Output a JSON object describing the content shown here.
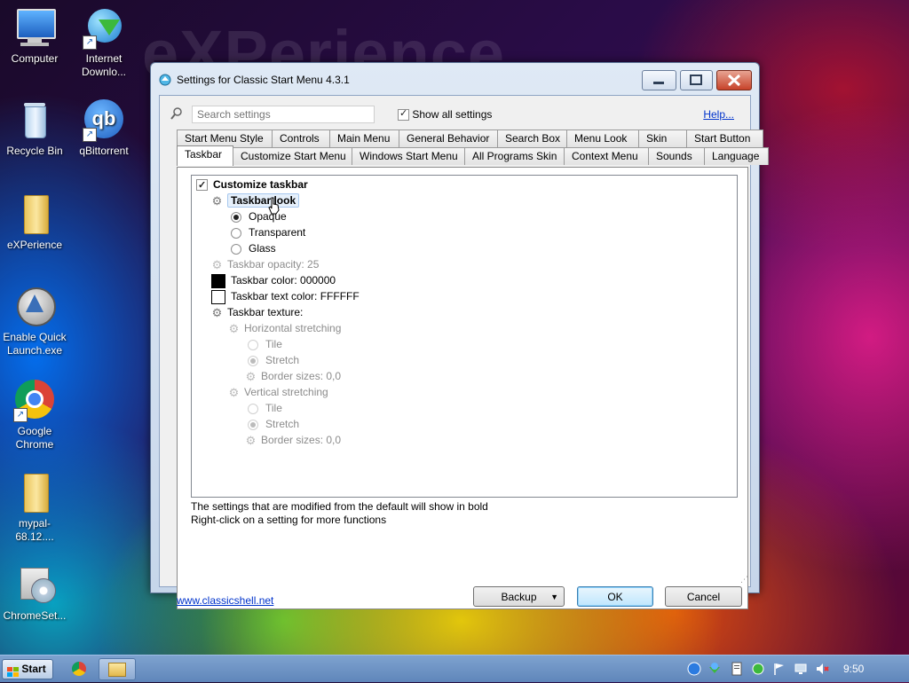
{
  "desktop": {
    "watermark": "eXPerience",
    "icons": [
      {
        "label": "Computer"
      },
      {
        "label": "Internet Downlo..."
      },
      {
        "label": "Recycle Bin"
      },
      {
        "label": "qBittorrent"
      },
      {
        "label": "eXPerience"
      },
      {
        "label": "Enable Quick Launch.exe"
      },
      {
        "label": "Google Chrome"
      },
      {
        "label": "mypal-68.12...."
      },
      {
        "label": "ChromeSet..."
      }
    ]
  },
  "dialog": {
    "title": "Settings for Classic Start Menu 4.3.1",
    "search_placeholder": "Search settings",
    "show_all_label": "Show all settings",
    "show_all_checked": true,
    "help_link": "Help...",
    "tabs_row1": [
      "Start Menu Style",
      "Controls",
      "Main Menu",
      "General Behavior",
      "Search Box",
      "Menu Look",
      "Skin",
      "Start Button"
    ],
    "tabs_row2": [
      "Taskbar",
      "Customize Start Menu",
      "Windows Start Menu",
      "All Programs Skin",
      "Context Menu",
      "Sounds",
      "Language"
    ],
    "active_tab": "Taskbar",
    "tree": {
      "customize_taskbar": "Customize taskbar",
      "taskbar_look": "Taskbar look",
      "opaque": "Opaque",
      "transparent": "Transparent",
      "glass": "Glass",
      "opacity": "Taskbar opacity: 25",
      "color": "Taskbar color: 000000",
      "color_hex": "#000000",
      "text_color": "Taskbar text color: FFFFFF",
      "text_color_hex": "#FFFFFF",
      "texture": "Taskbar texture:",
      "h_stretching": "Horizontal stretching",
      "h_tile": "Tile",
      "h_stretch": "Stretch",
      "h_border": "Border sizes: 0,0",
      "v_stretching": "Vertical stretching",
      "v_tile": "Tile",
      "v_stretch": "Stretch",
      "v_border": "Border sizes: 0,0"
    },
    "note_line1": "The settings that are modified from the default will show in bold",
    "note_line2": "Right-click on a setting for more functions",
    "website_link": "www.classicshell.net",
    "backup_label": "Backup",
    "ok_label": "OK",
    "cancel_label": "Cancel"
  },
  "taskbar": {
    "start_label": "Start",
    "clock": "9:50"
  }
}
